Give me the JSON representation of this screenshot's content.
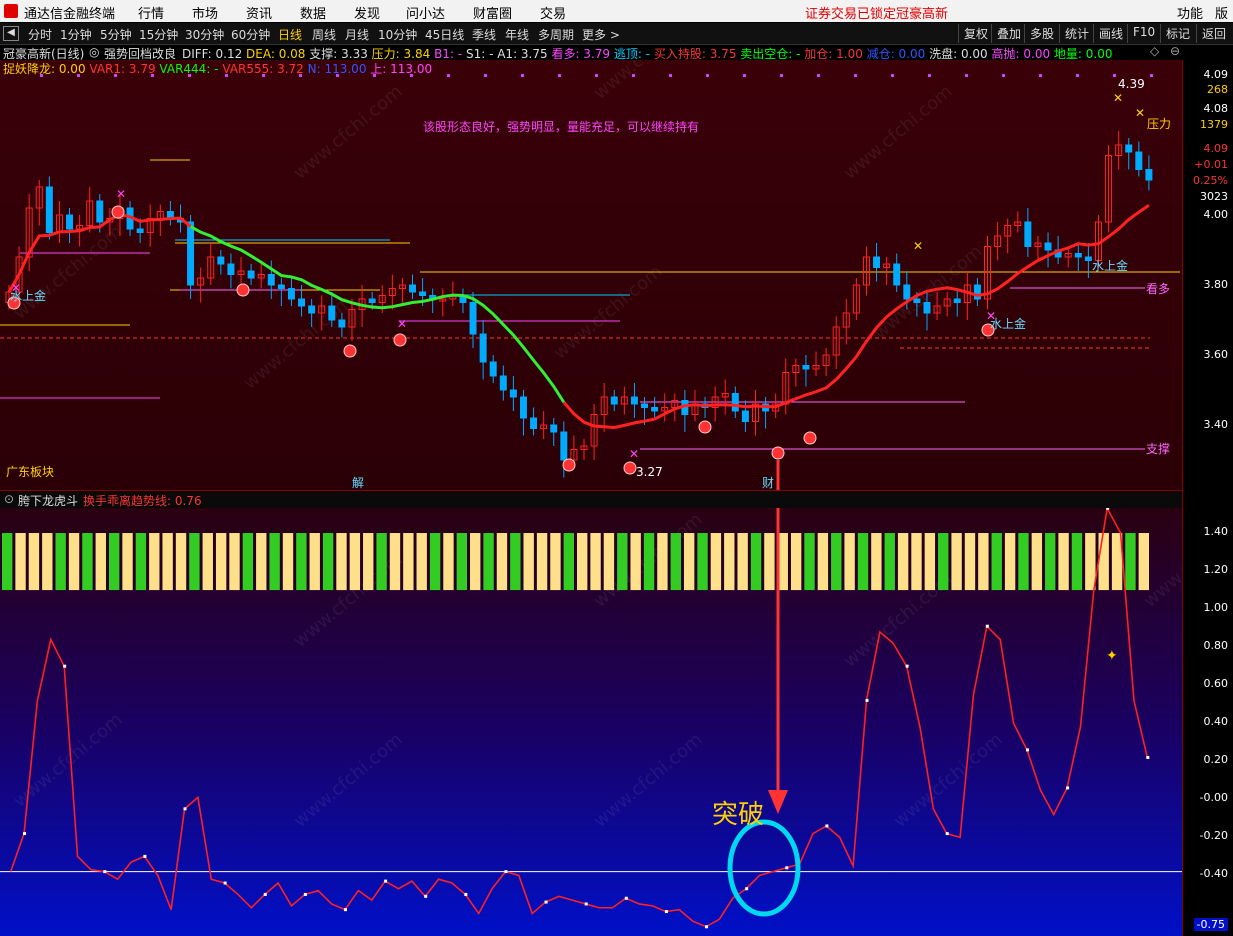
{
  "menubar": {
    "app_title": "通达信金融终端",
    "items": [
      "行情",
      "市场",
      "资讯",
      "数据",
      "发现",
      "问小达",
      "财富圈",
      "交易"
    ],
    "status_locked": "证券交易已锁定",
    "status_name": "冠豪高新",
    "right_items": [
      "功能",
      "版面"
    ]
  },
  "periodbar": {
    "periods": [
      "分时",
      "1分钟",
      "5分钟",
      "15分钟",
      "30分钟",
      "60分钟",
      "日线",
      "周线",
      "月线",
      "10分钟",
      "45日线",
      "季线",
      "年线",
      "多周期",
      "更多 >"
    ],
    "active": "日线",
    "right_buttons": [
      "复权",
      "叠加",
      "多股",
      "统计",
      "画线",
      "F10",
      "标记",
      "返回"
    ]
  },
  "indicator_line1": {
    "stock": "冠豪高新(日线)",
    "formula": "强势回档改良",
    "items": [
      {
        "t": "DIFF: 0.12",
        "c": "#dddddd"
      },
      {
        "t": "DEA: 0.08",
        "c": "#ffd000"
      },
      {
        "t": "支撑: 3.33",
        "c": "#dddddd"
      },
      {
        "t": "压力: 3.84",
        "c": "#ffd000"
      },
      {
        "t": "B1: -",
        "c": "#ff44ff"
      },
      {
        "t": "S1: -",
        "c": "#dddddd"
      },
      {
        "t": "A1: 3.75",
        "c": "#dddddd"
      },
      {
        "t": "看多: 3.79",
        "c": "#ff44ff"
      },
      {
        "t": "逃顶: -",
        "c": "#00ccff"
      },
      {
        "t": "买入持股: 3.75",
        "c": "#ff3333"
      },
      {
        "t": "卖出空仓: -",
        "c": "#00ff00"
      },
      {
        "t": "加仓: 1.00",
        "c": "#ff3333"
      },
      {
        "t": "减仓: 0.00",
        "c": "#3355ff"
      },
      {
        "t": "洗盘: 0.00",
        "c": "#dddddd"
      },
      {
        "t": "高抛: 0.00",
        "c": "#ff44ff"
      },
      {
        "t": "地量: 0.00",
        "c": "#00ff00"
      }
    ]
  },
  "indicator_line2": {
    "items": [
      {
        "t": "捉妖降龙: 0.00",
        "c": "#ffd000"
      },
      {
        "t": "VAR1: 3.79",
        "c": "#ff3333"
      },
      {
        "t": "VAR444: -",
        "c": "#00ff00"
      },
      {
        "t": "VAR555: 3.72",
        "c": "#ff3333"
      },
      {
        "t": "N: 113.00",
        "c": "#3355ff"
      },
      {
        "t": "上: 113.00",
        "c": "#ff44ff"
      }
    ]
  },
  "main_chart": {
    "comment": "该股形态良好，强势明显，量能充足，可以继续持有",
    "sector": "广东板块",
    "labels": {
      "jie": "解",
      "cai": "财",
      "water_gold": "水上金",
      "pressure": "压力",
      "bullish": "看多",
      "support": "支撑",
      "high": "4.39",
      "low": "3.27"
    },
    "watermark": "www.cfchi.com"
  },
  "right_axis": {
    "main_top": [
      "4.09",
      "268",
      "4.08",
      "1379",
      "4.09",
      "+0.01",
      "0.25%",
      "3023"
    ],
    "main_ticks": [
      "4.00",
      "3.80",
      "3.60",
      "3.40"
    ],
    "sub_ticks": [
      "1.40",
      "1.20",
      "1.00",
      "0.80",
      "0.60",
      "0.40",
      "0.20",
      "-0.00",
      "-0.20",
      "-0.40"
    ],
    "sub_current": "-0.75"
  },
  "sub_chart": {
    "title": "胯下龙虎斗",
    "series_label": "换手乖离趋势线: 0.76",
    "annotation": "突破"
  },
  "chart_data": {
    "type": "line",
    "ylim": [
      -0.75,
      1.5
    ],
    "series": [
      {
        "name": "换手乖离趋势线",
        "values": [
          -0.38,
          -0.18,
          0.52,
          0.84,
          0.7,
          -0.3,
          -0.37,
          -0.38,
          -0.42,
          -0.33,
          -0.3,
          -0.4,
          -0.58,
          -0.05,
          0.01,
          -0.42,
          -0.44,
          -0.5,
          -0.57,
          -0.5,
          -0.44,
          -0.56,
          -0.5,
          -0.48,
          -0.55,
          -0.58,
          -0.48,
          -0.53,
          -0.43,
          -0.47,
          -0.43,
          -0.51,
          -0.42,
          -0.44,
          -0.5,
          -0.6,
          -0.47,
          -0.38,
          -0.4,
          -0.6,
          -0.54,
          -0.51,
          -0.53,
          -0.55,
          -0.57,
          -0.57,
          -0.52,
          -0.55,
          -0.56,
          -0.59,
          -0.58,
          -0.64,
          -0.67,
          -0.63,
          -0.52,
          -0.47,
          -0.4,
          -0.38,
          -0.36,
          -0.34,
          -0.18,
          -0.14,
          -0.2,
          -0.35,
          0.52,
          0.88,
          0.82,
          0.7,
          0.38,
          -0.05,
          -0.18,
          -0.2,
          0.55,
          0.91,
          0.84,
          0.4,
          0.26,
          0.05,
          -0.08,
          0.06,
          0.38,
          1.1,
          1.53,
          1.4,
          0.52,
          0.22
        ]
      }
    ]
  }
}
